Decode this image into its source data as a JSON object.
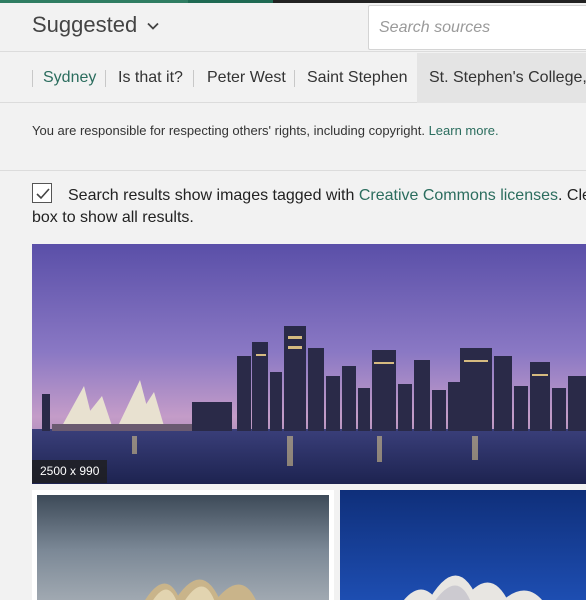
{
  "header": {
    "title": "Suggested",
    "search_placeholder": "Search sources"
  },
  "tabs": [
    {
      "label": "Sydney"
    },
    {
      "label": "Is that it?"
    },
    {
      "label": "Peter West"
    },
    {
      "label": "Saint Stephen"
    },
    {
      "label": "St. Stephen's College,"
    }
  ],
  "notice": {
    "text": "You are responsible for respecting others' rights, including copyright. ",
    "link": "Learn more."
  },
  "creative_commons": {
    "checked": true,
    "text_before": "Search results show images tagged with ",
    "link": "Creative Commons licenses",
    "text_after": ". Cle",
    "line2": "box to show all results."
  },
  "results": {
    "main_dims": "2500 x 990"
  },
  "colors": {
    "accent": "#2b6d5e",
    "background": "#f2f2f2"
  }
}
